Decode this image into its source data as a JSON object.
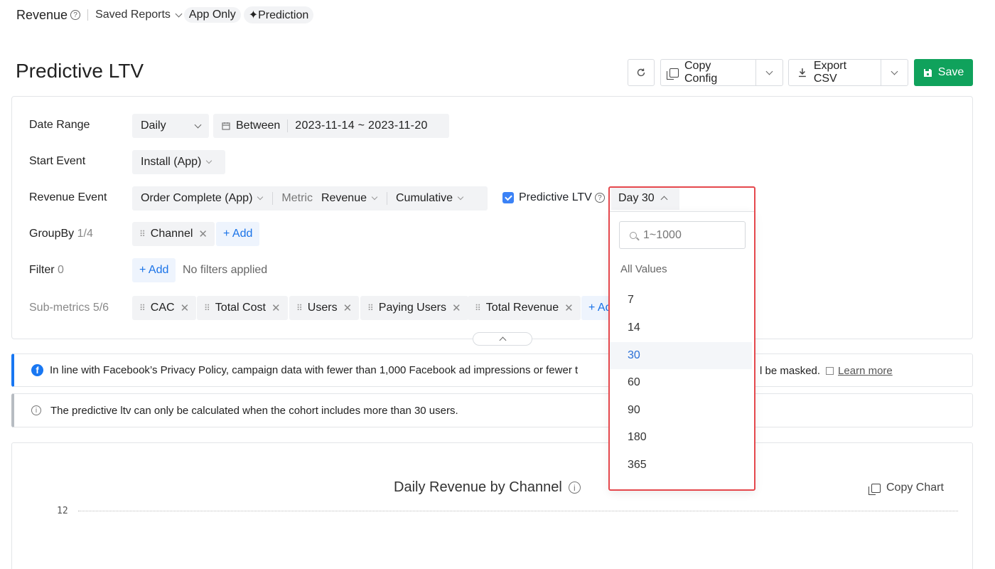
{
  "topbar": {
    "title": "Revenue",
    "saved_reports": "Saved Reports",
    "pill_app": "App Only",
    "pill_prediction": "Prediction"
  },
  "header": {
    "title": "Predictive LTV",
    "copy_config": "Copy Config",
    "export_csv": "Export CSV",
    "save": "Save"
  },
  "config": {
    "date_range": {
      "label": "Date Range",
      "granularity": "Daily",
      "between": "Between",
      "range": "2023-11-14 ~ 2023-11-20"
    },
    "start_event": {
      "label": "Start Event",
      "value": "Install (App)"
    },
    "revenue_event": {
      "label": "Revenue Event",
      "event": "Order Complete (App)",
      "metric_label": "Metric",
      "metric": "Revenue",
      "mode": "Cumulative",
      "predictive_label": "Predictive LTV",
      "predictive_checked": true,
      "day": "Day 30"
    },
    "groupby": {
      "label": "GroupBy",
      "count": "1/4",
      "chips": [
        "Channel"
      ],
      "add": "+ Add"
    },
    "filter": {
      "label": "Filter",
      "count": "0",
      "add": "+ Add",
      "empty": "No filters applied"
    },
    "submetrics": {
      "label": "Sub-metrics",
      "count": "5/6",
      "chips": [
        "CAC",
        "Total Cost",
        "Users",
        "Paying Users",
        "Total Revenue"
      ],
      "add": "+ Ad"
    }
  },
  "notices": {
    "facebook": {
      "text": "In line with Facebook’s Privacy Policy, campaign data with fewer than 1,000 Facebook ad impressions or fewer t",
      "tail": "l be masked.",
      "link": "Learn more"
    },
    "info": {
      "text": "The predictive ltv can only be calculated when the cohort includes more than 30 users."
    }
  },
  "chart": {
    "title": "Daily Revenue by Channel",
    "copy": "Copy Chart",
    "y_tick_top": "12"
  },
  "dropdown": {
    "placeholder": "1~1000",
    "group_label": "All Values",
    "options": [
      "7",
      "14",
      "30",
      "60",
      "90",
      "180",
      "365"
    ],
    "selected": "30"
  },
  "colors": {
    "save_green": "#10a25c",
    "link_blue": "#1a73e8",
    "highlight_red": "#e5484d",
    "facebook_blue": "#1877f2"
  }
}
